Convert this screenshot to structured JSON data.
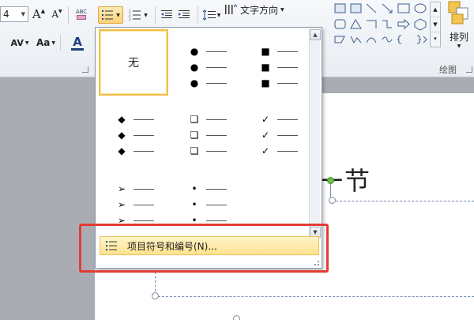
{
  "ribbon": {
    "font_size_value": "4",
    "grow_font_label": "A",
    "shrink_font_label": "A",
    "char_spacing_label": "AV",
    "change_case_label": "Aa",
    "font_color_label": "A",
    "clear_format_label": "ABC",
    "text_direction_label": "文字方向",
    "arrange_label": "排列",
    "drawing_group_label": "绘图"
  },
  "slide": {
    "title_text": "第一节"
  },
  "bullet_dropdown": {
    "none_label": "无",
    "styles": [
      {
        "id": "none",
        "glyph": ""
      },
      {
        "id": "filled-circle",
        "glyph": "●"
      },
      {
        "id": "filled-square",
        "glyph": "■"
      },
      {
        "id": "diamond",
        "glyph": "◆"
      },
      {
        "id": "hollow-square",
        "glyph": "❑"
      },
      {
        "id": "checkmark",
        "glyph": "✓"
      },
      {
        "id": "arrow",
        "glyph": "➢"
      },
      {
        "id": "small-dot",
        "glyph": "•"
      }
    ],
    "menu_item_label": "项目符号和编号(N)..."
  },
  "colors": {
    "highlight_border": "#e43b35",
    "selected_border": "#f0c04a",
    "menu_item_bg": "#fde38f",
    "placeholder_dash": "#6f86a3",
    "rotate_handle": "#6cc04a"
  }
}
